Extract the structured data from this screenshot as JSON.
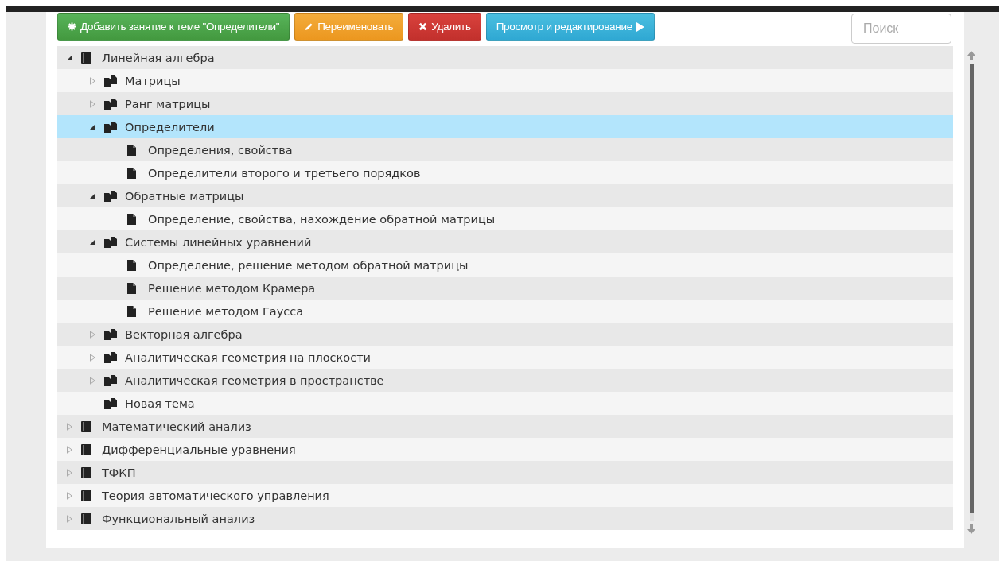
{
  "toolbar": {
    "buttons": [
      {
        "kind": "add",
        "label": "Добавить занятие к теме \"Определители\""
      },
      {
        "kind": "rename",
        "label": "Переименовать"
      },
      {
        "kind": "delete",
        "label": "Удалить"
      },
      {
        "kind": "view",
        "label": "Просмотр и редактирование"
      }
    ],
    "search": {
      "placeholder": "Поиск"
    }
  },
  "tree": [
    {
      "label": "Линейная алгебра",
      "expanded": true,
      "selected": false,
      "children": [
        {
          "label": "Матрицы",
          "expanded": false,
          "selected": false
        },
        {
          "label": "Ранг матрицы",
          "expanded": false,
          "selected": false
        },
        {
          "label": "Определители",
          "expanded": true,
          "selected": true,
          "children": [
            {
              "label": "Определения, свойства",
              "selected": false
            },
            {
              "label": "Определители второго и третьего порядков",
              "selected": false
            }
          ]
        },
        {
          "label": "Обратные матрицы",
          "expanded": true,
          "selected": false,
          "children": [
            {
              "label": "Определение, свойства, нахождение обратной матрицы",
              "selected": false
            }
          ]
        },
        {
          "label": "Системы линейных уравнений",
          "expanded": true,
          "selected": false,
          "children": [
            {
              "label": "Определение, решение методом обратной матрицы",
              "selected": false
            },
            {
              "label": "Решение методом Крамера",
              "selected": false
            },
            {
              "label": "Решение методом Гаусса",
              "selected": false
            }
          ]
        },
        {
          "label": "Векторная алгебра",
          "expanded": false,
          "selected": false
        },
        {
          "label": "Аналитическая геометрия на плоскости",
          "expanded": false,
          "selected": false
        },
        {
          "label": "Аналитическая геометрия в пространстве",
          "expanded": false,
          "selected": false
        },
        {
          "label": "Новая тема",
          "selected": false
        }
      ]
    },
    {
      "label": "Математический анализ",
      "expanded": false,
      "selected": false
    },
    {
      "label": "Дифференциальные уравнения",
      "expanded": false,
      "selected": false
    },
    {
      "label": "ТФКП",
      "expanded": false,
      "selected": false
    },
    {
      "label": "Теория автоматического управления",
      "expanded": false,
      "selected": false
    },
    {
      "label": "Функциональный анализ",
      "expanded": false,
      "selected": false
    }
  ]
}
